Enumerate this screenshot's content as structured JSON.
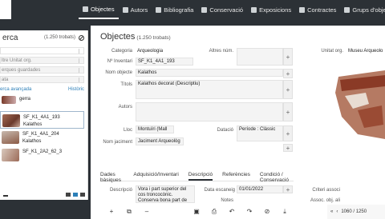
{
  "nav": {
    "items": [
      {
        "label": "Objectes",
        "icon": "table-icon",
        "active": true
      },
      {
        "label": "Autors",
        "icon": "user-icon"
      },
      {
        "label": "Bibliografia",
        "icon": "book-icon"
      },
      {
        "label": "Conservació",
        "icon": "wrench-icon"
      },
      {
        "label": "Exposicions",
        "icon": "eye-icon"
      },
      {
        "label": "Contractes",
        "icon": "document-icon"
      },
      {
        "label": "Grups d'objectes",
        "icon": "group-icon"
      }
    ]
  },
  "left": {
    "title": "erca",
    "count": "(1.250 trobats)",
    "filter_org": "ltre Unitat org.",
    "saved_searches": "erques guardades",
    "sort": "ata",
    "advanced_link": "erca avançada",
    "history_link": "Històric",
    "items": [
      {
        "code": "",
        "name": "gerra",
        "selected": false
      },
      {
        "code": "SF_K1_4A1_193",
        "name": "Kalathos",
        "selected": true
      },
      {
        "code": "SF_K1_4A1_204",
        "name": "Kalathos",
        "selected": false
      },
      {
        "code": "SF_K1_2A2_62_3",
        "name": "",
        "selected": false
      }
    ]
  },
  "main": {
    "title": "Objectes",
    "count": "(1.250 trobats)",
    "labels": {
      "categoria": "Categoria",
      "inventari": "Nº Inventari",
      "nom_objecte": "Nom objecte",
      "titols": "Títols",
      "autors": "Autors",
      "lloc": "Lloc",
      "datacio": "Datació",
      "nom_jaciment": "Nom jaciment",
      "altres_num": "Altres núm.",
      "descripcio": "Descripció",
      "data_escaneig": "Data escaneig",
      "notes": "Notes"
    },
    "values": {
      "categoria": "Arqueologia",
      "inventari": "SF_K1_4A1_193",
      "nom_objecte": "Kalathos",
      "titols": "Kalathos decorat (Descriptiu)",
      "lloc": "Montuïri (Mall",
      "datacio": "Període : Clàssic",
      "nom_jaciment": "Jaciment Arqueològ",
      "descripcio": "Vora i part superior del cos troncocònic.",
      "descripcio_more": "Conserva bona part de",
      "data_escaneig": "01/01/2022"
    },
    "tabs": [
      "Dades bàsiques",
      "Adquisició/Inventari",
      "Descripció",
      "Referències",
      "Condició / Conservació"
    ],
    "active_tab": 2
  },
  "right": {
    "unitat_label": "Unitat org.",
    "unitat_value": "Museu Arqueolo",
    "criteri_label": "Criteri associ",
    "assoc_label": "Assoc. obj. ali",
    "pager_text": "1060 / 1250"
  },
  "colors": {
    "nav_bg": "#2c3136",
    "link": "#2c7fb8",
    "field_bg": "#f4f4f4"
  }
}
